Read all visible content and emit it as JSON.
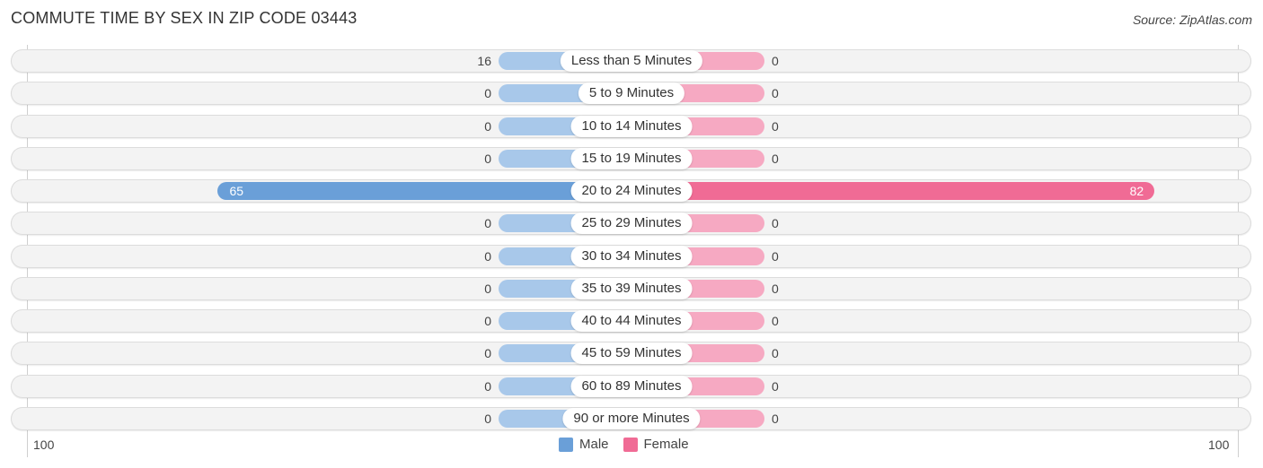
{
  "header": {
    "title": "COMMUTE TIME BY SEX IN ZIP CODE 03443",
    "source": "Source: ZipAtlas.com"
  },
  "colors": {
    "male": "#6a9fd8",
    "male_light": "#a8c8ea",
    "female": "#f06b95",
    "female_light": "#f6a9c2",
    "row_bg": "#f3f3f3"
  },
  "chart_data": {
    "type": "bar",
    "orientation": "horizontal-diverging",
    "title": "COMMUTE TIME BY SEX IN ZIP CODE 03443",
    "categories": [
      "Less than 5 Minutes",
      "5 to 9 Minutes",
      "10 to 14 Minutes",
      "15 to 19 Minutes",
      "20 to 24 Minutes",
      "25 to 29 Minutes",
      "30 to 34 Minutes",
      "35 to 39 Minutes",
      "40 to 44 Minutes",
      "45 to 59 Minutes",
      "60 to 89 Minutes",
      "90 or more Minutes"
    ],
    "series": [
      {
        "name": "Male",
        "values": [
          16,
          0,
          0,
          0,
          65,
          0,
          0,
          0,
          0,
          0,
          0,
          0
        ]
      },
      {
        "name": "Female",
        "values": [
          0,
          0,
          0,
          0,
          82,
          0,
          0,
          0,
          0,
          0,
          0,
          0
        ]
      }
    ],
    "axis": {
      "left_label": "100",
      "right_label": "100",
      "range": [
        -100,
        100
      ]
    },
    "legend": {
      "position": "bottom-center",
      "entries": [
        "Male",
        "Female"
      ]
    },
    "xlabel": "",
    "ylabel": ""
  }
}
